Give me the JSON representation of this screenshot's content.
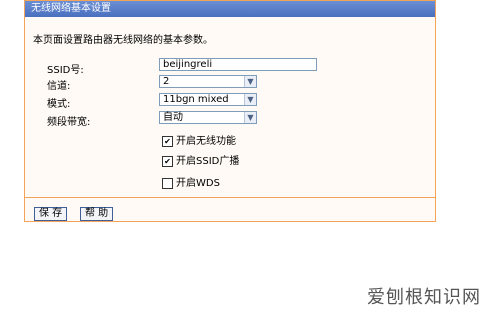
{
  "window": {
    "title": "无线网络基本设置"
  },
  "description": "本页面设置路由器无线网络的基本参数。",
  "fields": {
    "ssid_label": "SSID号:",
    "ssid_value": "beijingreli",
    "channel_label": "信道:",
    "channel_value": "2",
    "mode_label": "模式:",
    "mode_value": "11bgn mixed",
    "bandwidth_label": "频段带宽:",
    "bandwidth_value": "自动"
  },
  "checkboxes": [
    {
      "label": "开启无线功能",
      "checked": true
    },
    {
      "label": "开启SSID广播",
      "checked": true
    },
    {
      "label": "开启WDS",
      "checked": false
    }
  ],
  "buttons": {
    "save": "保 存",
    "help": "帮 助"
  },
  "watermark": "爱刨根知识网",
  "colors": {
    "panel_border": "#f3a35a",
    "titlebar": "#4a6fbf"
  }
}
